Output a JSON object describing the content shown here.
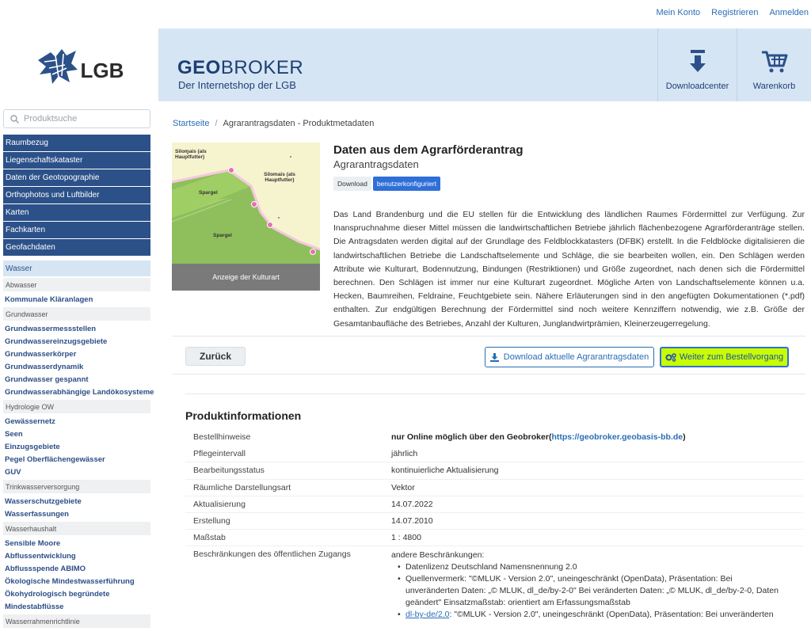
{
  "toplinks": {
    "account": "Mein Konto",
    "register": "Registrieren",
    "login": "Anmelden"
  },
  "logo": {
    "text": "LGB"
  },
  "header": {
    "brand_bold": "GEO",
    "brand_rest": "BROKER",
    "brand_sub": "Der Internetshop der LGB",
    "download_label": "Downloadcenter",
    "cart_label": "Warenkorb"
  },
  "sidebar": {
    "search_placeholder": "Produktsuche",
    "nav": [
      "Raumbezug",
      "Liegenschaftskataster",
      "Daten der Geotopographie",
      "Orthophotos und Luftbilder",
      "Karten",
      "Fachkarten",
      "Geofachdaten"
    ],
    "selected": "Wasser",
    "groups": [
      {
        "cat": "Abwasser",
        "items": [
          "Kommunale Kläranlagen"
        ]
      },
      {
        "cat": "Grundwasser",
        "items": [
          "Grundwassermessstellen",
          "Grundwassereinzugsgebiete",
          "Grundwasserkörper",
          "Grundwasserdynamik",
          "Grundwasser gespannt",
          "Grundwasserabhängige Landökosysteme"
        ]
      },
      {
        "cat": "Hydrologie OW",
        "items": [
          "Gewässernetz",
          "Seen",
          "Einzugsgebiete",
          "Pegel Oberflächengewässer",
          "GUV"
        ]
      },
      {
        "cat": "Trinkwasserversorgung",
        "items": [
          "Wasserschutzgebiete",
          "Wasserfassungen"
        ]
      },
      {
        "cat": "Wasserhaushalt",
        "items": [
          "Sensible Moore",
          "Abflussentwicklung",
          "Abflussspende ABIMO",
          "Ökologische Mindestwasserführung",
          "Ökohydrologisch begründete",
          "Mindestabflüsse"
        ]
      },
      {
        "cat": "Wasserrahmenrichtlinie",
        "items": []
      }
    ]
  },
  "breadcrumb": {
    "home": "Startseite",
    "current": "Agrarantragsdaten - Produktmetadaten"
  },
  "thumb": {
    "caption": "Anzeige der Kulturart",
    "labels": {
      "silomais1": "Silomais (als Hauptfutter)",
      "silomais2": "Silomais (als Hauptfutter)",
      "spargel1": "Spargel",
      "spargel2": "Spargel"
    }
  },
  "product": {
    "title": "Daten aus dem Agrarförderantrag",
    "subtitle": "Agrarantragsdaten",
    "tag1": "Download",
    "tag2": "benutzerkonfiguriert",
    "description": "Das Land Brandenburg und die EU stellen für die Entwicklung des ländlichen Raumes Fördermittel zur Verfügung. Zur Inanspruchnahme dieser Mittel müssen die landwirtschaftlichen Betriebe jährlich flächenbezogene Agrarförderanträge stellen. Die Antragsdaten werden digital auf der Grundlage des Feldblockkatasters (DFBK) erstellt. In die Feldblöcke digitalisieren die landwirtschaftlichen Betriebe die Landschaftselemente und Schläge, die sie bearbeiten wollen, ein. Den Schlägen werden Attribute wie Kulturart, Bodennutzung, Bindungen (Restriktionen) und Größe zugeordnet, nach denen sich die Fördermittel berechnen. Den Schlägen ist immer nur eine Kulturart zugeordnet. Mögliche Arten von Landschaftselemente können u.a. Hecken, Baumreihen, Feldraine, Feuchtgebiete sein. Nähere Erläuterungen sind in den angefügten Dokumentationen (*.pdf) enthalten. Zur endgültigen Berechnung der Fördermittel sind noch weitere Kennziffern notwendig, wie z.B. Größe der Gesamtanbaufläche des Betriebes, Anzahl der Kulturen, Junglandwirtprämien, Kleinerzeugerregelung."
  },
  "actions": {
    "back": "Zurück",
    "download": "Download aktuelle Agrarantragsdaten",
    "order": "Weiter zum Bestellvorgang"
  },
  "info": {
    "heading": "Produktinformationen",
    "order_key": "Bestellhinweise",
    "order_value_prefix": "nur Online möglich über den Geobroker(",
    "order_value_link": "https://geobroker.geobasis-bb.de",
    "order_value_suffix": ")",
    "rows": [
      {
        "k": "Pflegeintervall",
        "v": "jährlich"
      },
      {
        "k": "Bearbeitungsstatus",
        "v": "kontinuierliche Aktualisierung"
      },
      {
        "k": "Räumliche Darstellungsart",
        "v": "Vektor"
      },
      {
        "k": "Aktualisierung",
        "v": "14.07.2022"
      },
      {
        "k": "Erstellung",
        "v": "14.07.2010"
      },
      {
        "k": "Maßstab",
        "v": "1 : 4800"
      }
    ],
    "restr_key": "Beschränkungen des öffentlichen Zugangs",
    "restr_intro": "andere Beschränkungen:",
    "restr_items": [
      "Datenlizenz Deutschland Namensnennung 2.0",
      "Quellenvermerk: \"©MLUK - Version 2.0\", uneingeschränkt (OpenData), Präsentation: Bei unveränderten Daten: „© MLUK, dl_de/by-2-0\" Bei veränderten Daten: „© MLUK, dl_de/by-2-0, Daten geändert\" Einsatzmaßstab: orientiert am Erfassungsmaßstab"
    ],
    "restr_last_link": "dl-by-de/2.0",
    "restr_last_text": ": \"©MLUK - Version 2.0\", uneingeschränkt (OpenData), Präsentation: Bei unveränderten"
  }
}
